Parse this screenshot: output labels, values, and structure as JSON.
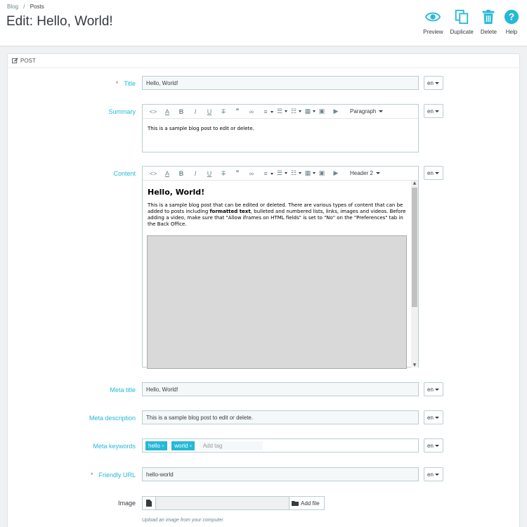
{
  "breadcrumb": {
    "parent": "Blog",
    "separator": "/",
    "current": "Posts"
  },
  "page_title": "Edit: Hello, World!",
  "toolbar": {
    "preview": "Preview",
    "duplicate": "Duplicate",
    "delete": "Delete",
    "help": "Help"
  },
  "colors": {
    "accent": "#25b9d7",
    "required": "#c05c67",
    "text": "#363a41"
  },
  "panel": {
    "heading": "POST"
  },
  "fields": {
    "title": {
      "label": "Title",
      "value": "Hello, World!",
      "lang": "en",
      "required_mark": "*"
    },
    "summary": {
      "label": "Summary",
      "format": "Paragraph",
      "lang": "en",
      "body": "This is a sample blog post to edit or delete."
    },
    "content": {
      "label": "Content",
      "format": "Header 2",
      "lang": "en",
      "heading": "Hello, World!",
      "body_pre": "This is a sample blog post that can be edited or deleted. There are various types of content that can be added to posts including ",
      "body_bold": "formatted text",
      "body_post": ", bulleted and numbered lists, links, images and videos. Before adding a video, make sure that \"Allow iframes on HTML fields\" is set to \"No\" on the \"Preferences\" tab in the Back Office."
    },
    "meta_title": {
      "label": "Meta title",
      "value": "Hello, World!",
      "lang": "en"
    },
    "meta_description": {
      "label": "Meta description",
      "value": "This is a sample blog post to edit or delete.",
      "lang": "en"
    },
    "meta_keywords": {
      "label": "Meta keywords",
      "tags": [
        "hello",
        "world"
      ],
      "placeholder": "Add tag",
      "lang": "en"
    },
    "friendly_url": {
      "label": "Friendly URL",
      "value": "hello-world",
      "lang": "en",
      "required_mark": "*"
    },
    "image": {
      "label": "Image",
      "button": "Add file",
      "help": "Upload an image from your computer."
    }
  }
}
